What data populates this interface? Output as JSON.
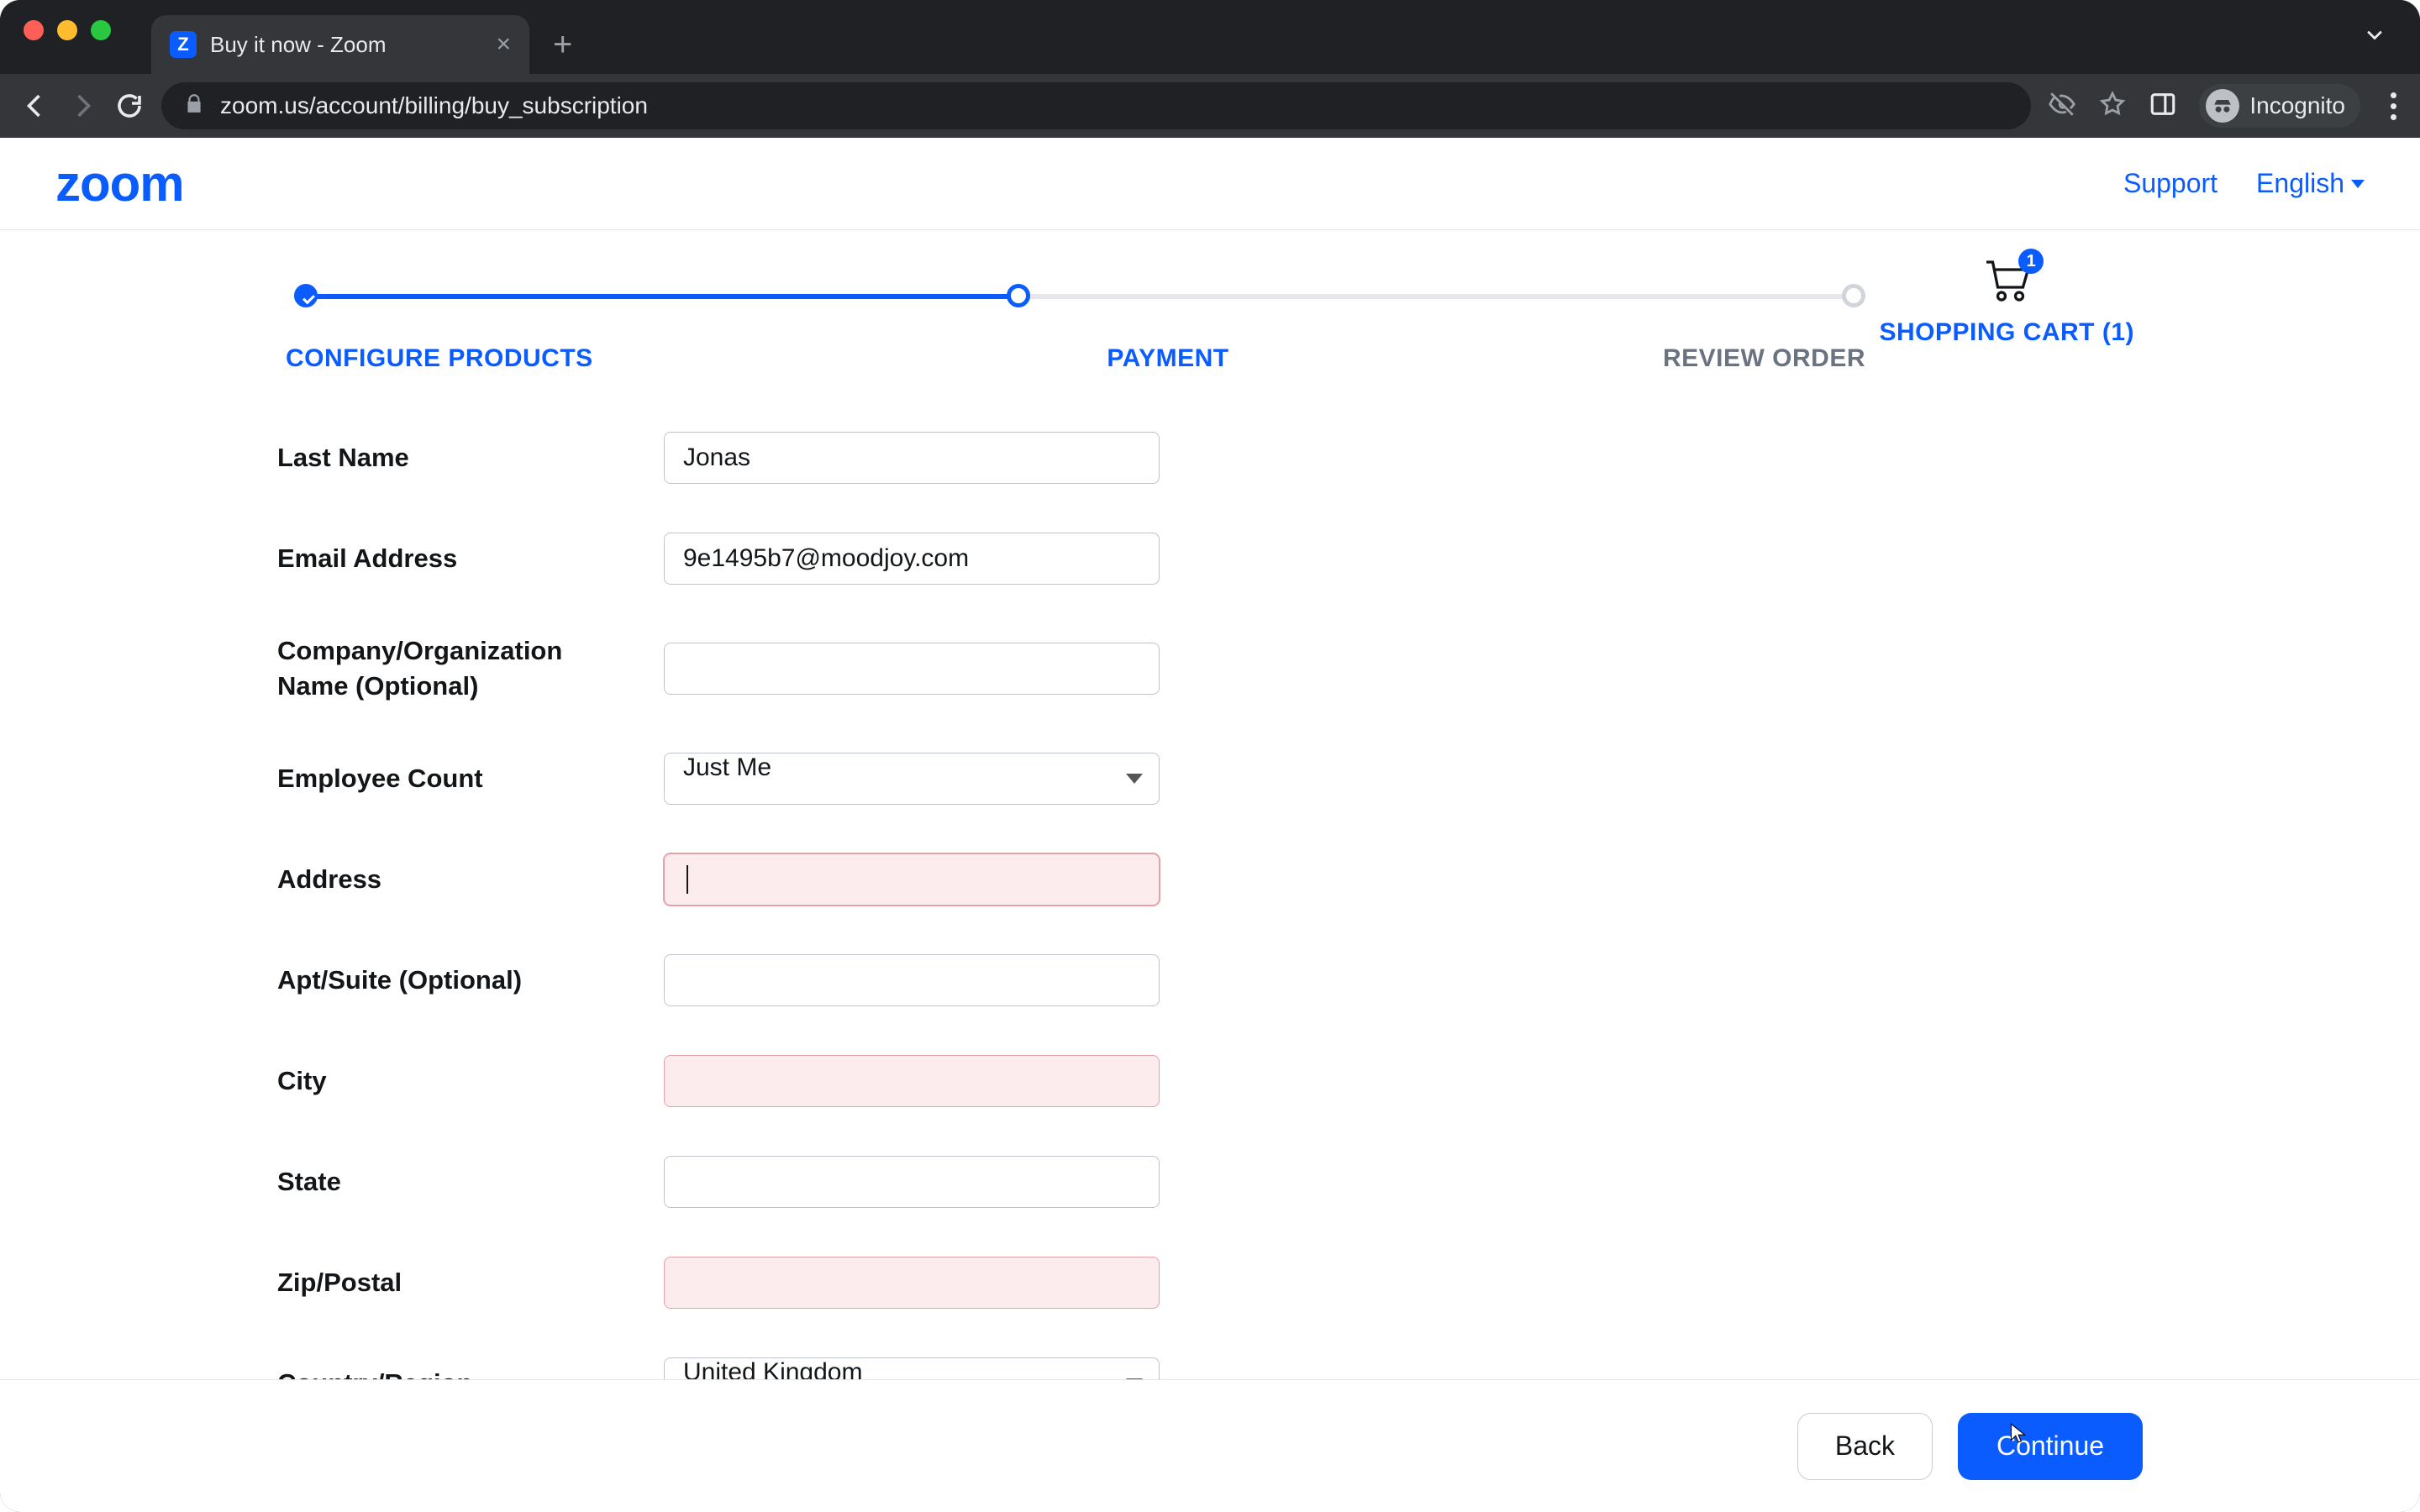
{
  "browser": {
    "tab_title": "Buy it now - Zoom",
    "url": "zoom.us/account/billing/buy_subscription",
    "incognito_label": "Incognito"
  },
  "header": {
    "logo_text": "zoom",
    "support": "Support",
    "language": "English"
  },
  "progress": {
    "step1": "CONFIGURE PRODUCTS",
    "step2": "PAYMENT",
    "step3": "REVIEW ORDER",
    "cart_label": "SHOPPING CART (1)",
    "cart_badge": "1"
  },
  "form": {
    "last_name": {
      "label": "Last Name",
      "value": "Jonas"
    },
    "email": {
      "label": "Email Address",
      "value": "9e1495b7@moodjoy.com"
    },
    "company": {
      "label": "Company/Organization Name (Optional)",
      "value": ""
    },
    "employee": {
      "label": "Employee Count",
      "value": "Just Me"
    },
    "address": {
      "label": "Address",
      "value": ""
    },
    "apt": {
      "label": "Apt/Suite (Optional)",
      "value": ""
    },
    "city": {
      "label": "City",
      "value": ""
    },
    "state": {
      "label": "State",
      "value": ""
    },
    "zip": {
      "label": "Zip/Postal",
      "value": ""
    },
    "country": {
      "label": "Country/Region",
      "value": "United Kingdom"
    }
  },
  "footer": {
    "back": "Back",
    "continue": "Continue"
  }
}
